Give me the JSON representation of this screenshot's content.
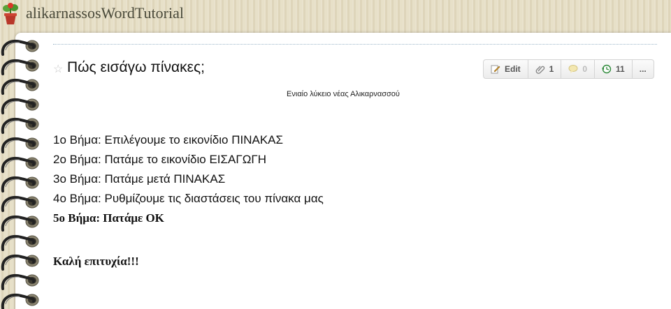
{
  "site": {
    "title": "alikarnassosWordTutorial"
  },
  "page": {
    "title": "Πώς εισάγω πίνακες;",
    "subtitle": "Ενιαίο λύκειο νέας Αλικαρνασσού"
  },
  "toolbar": {
    "edit_label": "Edit",
    "links_count": "1",
    "comments_count": "0",
    "history_count": "11",
    "more_label": "..."
  },
  "content": {
    "steps": [
      "1ο Βήμα: Επιλέγουμε το εικονίδιο ΠΙΝΑΚΑΣ",
      "2ο Βήμα: Πατάμε το εικονίδιο ΕΙΣΑΓΩΓΗ",
      "3ο Βήμα: Πατάμε μετά ΠΙΝΑΚΑΣ",
      "4ο Βήμα: Ρυθμίζουμε τις διαστάσεις του πίνακα μας",
      "5ο Βήμα: Πατάμε ΟΚ"
    ],
    "closing": "Καλή επιτυχία!!!"
  },
  "icons": {
    "logo": "potted-plant-icon",
    "star": "star-icon",
    "edit": "pencil-page-icon",
    "links": "paperclip-icon",
    "comments": "speech-bubble-icon",
    "history": "history-arrow-icon"
  },
  "colors": {
    "background": "#e4dcc2",
    "page": "#ffffff",
    "title_text": "#4a4a3a"
  }
}
